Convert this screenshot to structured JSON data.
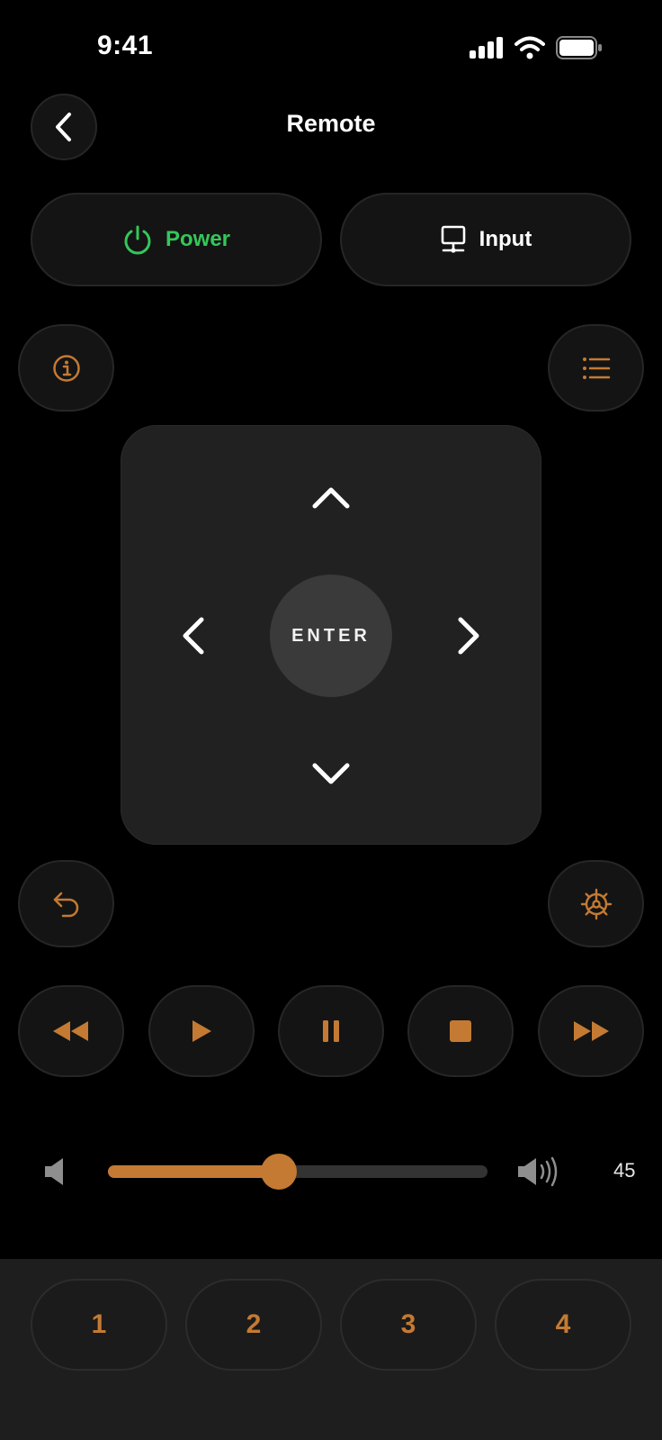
{
  "status_bar": {
    "time": "9:41"
  },
  "header": {
    "title": "Remote"
  },
  "buttons": {
    "power_label": "Power",
    "input_label": "Input"
  },
  "dpad": {
    "enter_label": "ENTER"
  },
  "volume": {
    "value": "45",
    "level_percent": 45
  },
  "number_buttons": [
    "1",
    "2",
    "3",
    "4"
  ],
  "colors": {
    "accent": "#C47A33",
    "power": "#34C759",
    "background": "#000000",
    "surface": "#141414"
  },
  "icons": {
    "back": "chevron-left-icon",
    "power": "power-icon",
    "input": "monitor-icon",
    "info": "info-icon",
    "menu": "list-icon",
    "back_nav": "return-icon",
    "settings": "gear-icon",
    "rewind": "rewind-icon",
    "play": "play-icon",
    "pause": "pause-icon",
    "stop": "stop-icon",
    "fast_forward": "fast-forward-icon",
    "volume_low": "speaker-icon",
    "volume_high": "speaker-wave-icon"
  }
}
